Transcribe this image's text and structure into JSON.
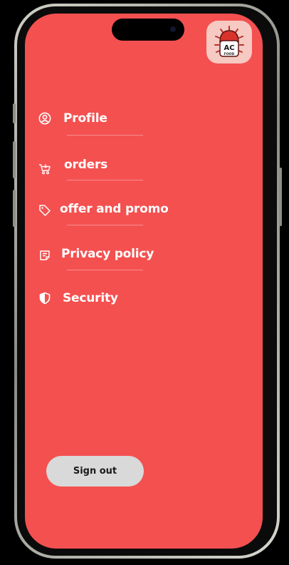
{
  "logo": {
    "text": "AC",
    "subtext": "FOOD"
  },
  "menu": {
    "items": [
      {
        "label": "Profile",
        "icon": "user-circle-icon"
      },
      {
        "label": "orders",
        "icon": "cart-icon"
      },
      {
        "label": "offer and promo",
        "icon": "tag-icon"
      },
      {
        "label": "Privacy policy",
        "icon": "document-icon"
      },
      {
        "label": "Security",
        "icon": "shield-icon"
      }
    ]
  },
  "signout": {
    "label": "Sign out"
  },
  "colors": {
    "background": "#f45050",
    "text": "#ffffff",
    "button": "#d9d9d9",
    "button_text": "#1a1a1a"
  }
}
